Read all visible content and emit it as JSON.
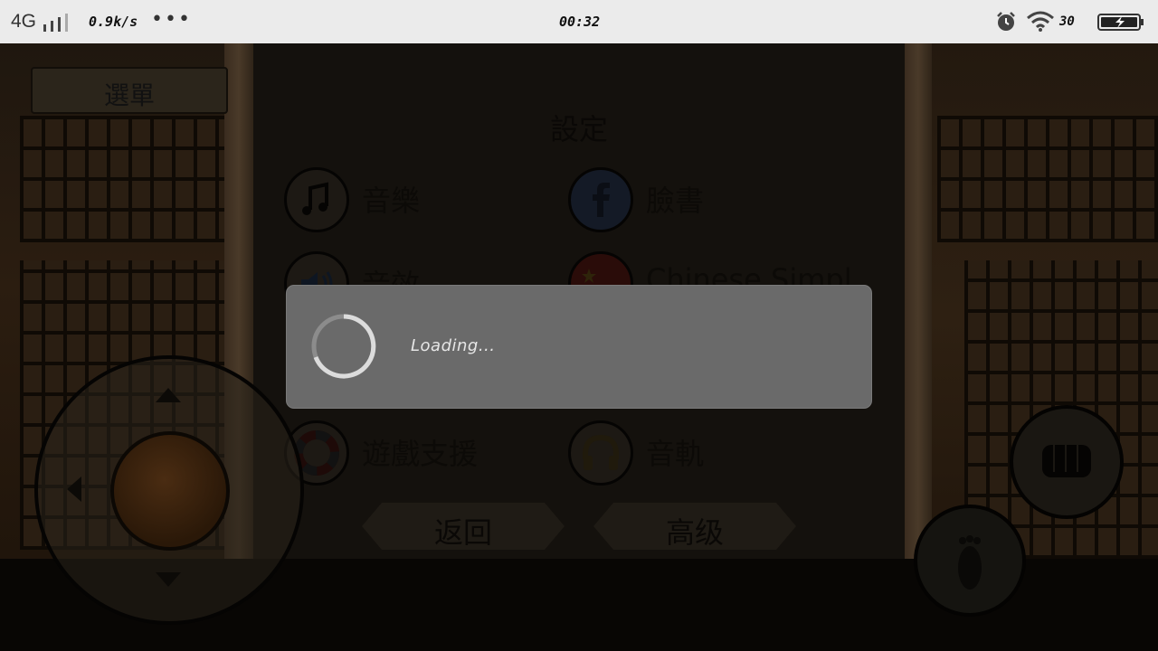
{
  "status_bar": {
    "network": "4G",
    "signal_icon": "cell-signal-icon",
    "speed": "0.9k/s",
    "more": "•••",
    "time": "00:32",
    "alarm_icon": "alarm-clock-icon",
    "wifi_icon": "wifi-icon",
    "wifi_speed": "30",
    "battery_icon": "battery-charging-icon"
  },
  "game": {
    "menu_button": "選單",
    "settings_title": "設定",
    "options": [
      {
        "label": "音樂",
        "icon": "music-note-icon"
      },
      {
        "label": "臉書",
        "icon": "facebook-icon"
      },
      {
        "label": "音效",
        "icon": "speaker-icon"
      },
      {
        "label": "Chinese Simpl",
        "icon": "china-flag-icon"
      },
      {
        "label": "遊戲支援",
        "icon": "support-lifebuoy-icon"
      },
      {
        "label": "音軌",
        "icon": "headphones-icon"
      }
    ],
    "buttons": {
      "back": "返回",
      "advanced": "高级"
    },
    "controls": {
      "joystick_icon": "joystick-icon",
      "punch_icon": "fist-icon",
      "kick_icon": "foot-icon"
    }
  },
  "loading_dialog": {
    "text": "Loading...",
    "spinner_icon": "spinner-icon"
  },
  "colors": {
    "dialog_bg": "#6a6a6a",
    "status_bar_bg": "#ebebeb",
    "scene_bg": "#0d0a07"
  }
}
